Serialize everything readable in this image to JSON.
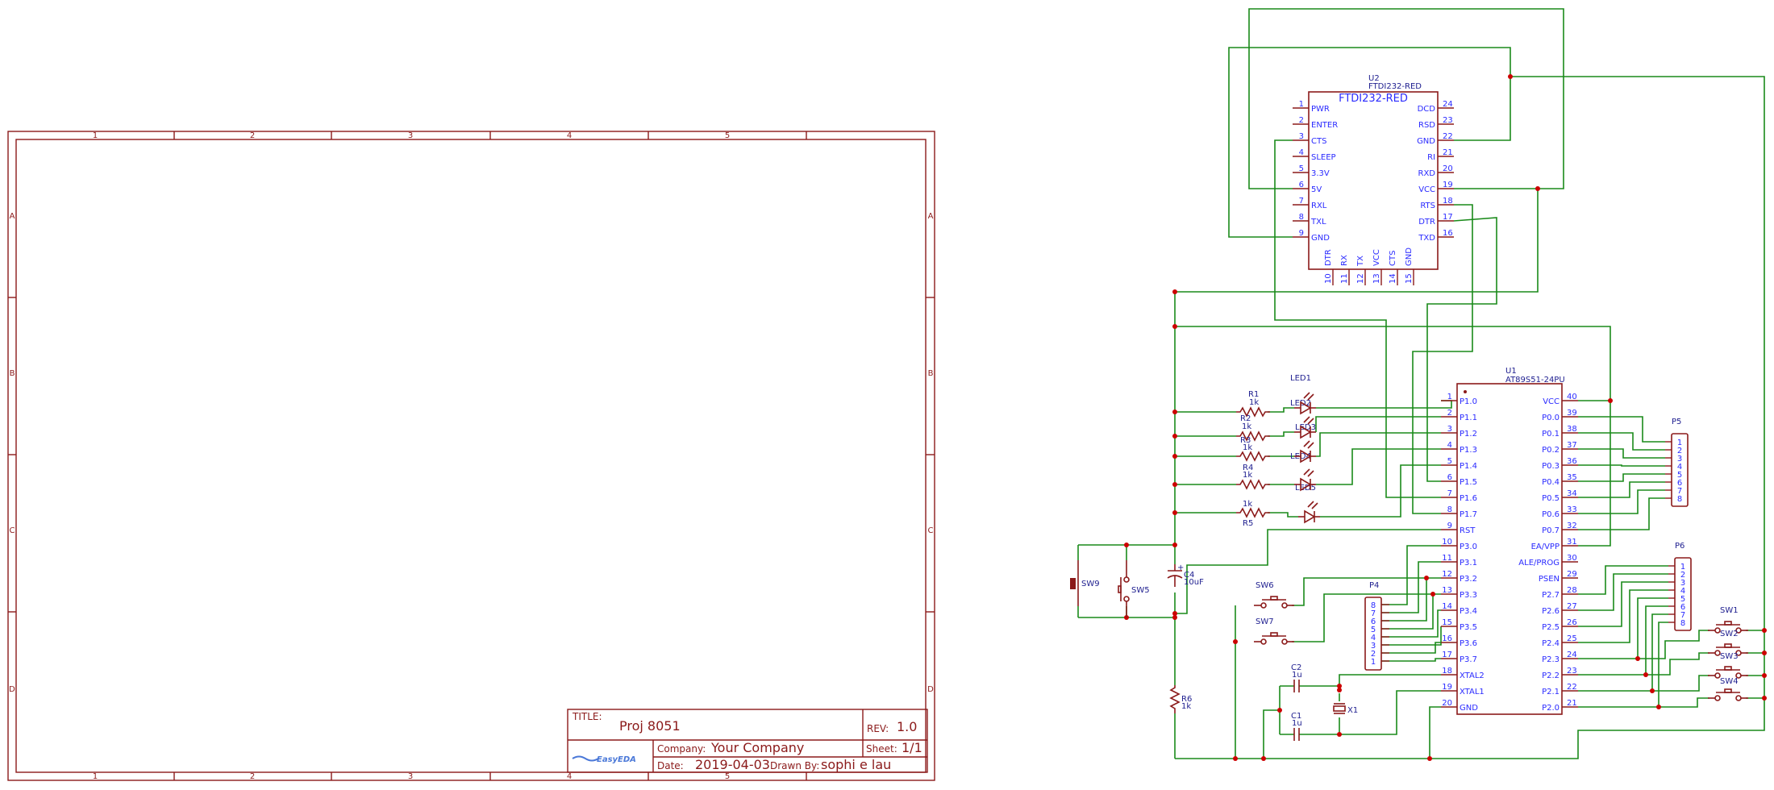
{
  "sheet": {
    "col_labels": [
      "1",
      "2",
      "3",
      "4",
      "5"
    ],
    "row_labels": [
      "A",
      "B",
      "C",
      "D"
    ]
  },
  "title_block": {
    "title_label": "TITLE:",
    "title": "Proj 8051",
    "rev_label": "REV:",
    "rev": "1.0",
    "company_label": "Company:",
    "company": "Your Company",
    "sheet_label": "Sheet:",
    "sheet": "1/1",
    "date_label": "Date:",
    "date": "2019-04-03",
    "drawn_by_label": "Drawn By:",
    "drawn_by": "sophi e lau",
    "logo": "EasyEDA"
  },
  "u2": {
    "ref": "U2",
    "part": "FTDI232-RED",
    "body_title": "FTDI232-RED",
    "left_pins": [
      {
        "num": "1",
        "name": "PWR"
      },
      {
        "num": "2",
        "name": "ENTER"
      },
      {
        "num": "3",
        "name": "CTS"
      },
      {
        "num": "4",
        "name": "SLEEP"
      },
      {
        "num": "5",
        "name": "3.3V"
      },
      {
        "num": "6",
        "name": "5V"
      },
      {
        "num": "7",
        "name": "RXL"
      },
      {
        "num": "8",
        "name": "TXL"
      },
      {
        "num": "9",
        "name": "GND"
      }
    ],
    "right_pins": [
      {
        "num": "24",
        "name": "DCD"
      },
      {
        "num": "23",
        "name": "RSD"
      },
      {
        "num": "22",
        "name": "GND"
      },
      {
        "num": "21",
        "name": "RI"
      },
      {
        "num": "20",
        "name": "RXD"
      },
      {
        "num": "19",
        "name": "VCC"
      },
      {
        "num": "18",
        "name": "RTS"
      },
      {
        "num": "17",
        "name": "DTR"
      },
      {
        "num": "16",
        "name": "TXD"
      }
    ],
    "bottom_pins": [
      {
        "num": "10",
        "name": "DTR"
      },
      {
        "num": "11",
        "name": "RX"
      },
      {
        "num": "12",
        "name": "TX"
      },
      {
        "num": "13",
        "name": "VCC"
      },
      {
        "num": "14",
        "name": "CTS"
      },
      {
        "num": "15",
        "name": "GND"
      }
    ]
  },
  "u1": {
    "ref": "U1",
    "part": "AT89S51-24PU",
    "left_pins": [
      {
        "num": "1",
        "name": "P1.0"
      },
      {
        "num": "2",
        "name": "P1.1"
      },
      {
        "num": "3",
        "name": "P1.2"
      },
      {
        "num": "4",
        "name": "P1.3"
      },
      {
        "num": "5",
        "name": "P1.4"
      },
      {
        "num": "6",
        "name": "P1.5"
      },
      {
        "num": "7",
        "name": "P1.6"
      },
      {
        "num": "8",
        "name": "P1.7"
      },
      {
        "num": "9",
        "name": "RST"
      },
      {
        "num": "10",
        "name": "P3.0"
      },
      {
        "num": "11",
        "name": "P3.1"
      },
      {
        "num": "12",
        "name": "P3.2"
      },
      {
        "num": "13",
        "name": "P3.3"
      },
      {
        "num": "14",
        "name": "P3.4"
      },
      {
        "num": "15",
        "name": "P3.5"
      },
      {
        "num": "16",
        "name": "P3.6"
      },
      {
        "num": "17",
        "name": "P3.7"
      },
      {
        "num": "18",
        "name": "XTAL2"
      },
      {
        "num": "19",
        "name": "XTAL1"
      },
      {
        "num": "20",
        "name": "GND"
      }
    ],
    "right_pins": [
      {
        "num": "40",
        "name": "VCC"
      },
      {
        "num": "39",
        "name": "P0.0"
      },
      {
        "num": "38",
        "name": "P0.1"
      },
      {
        "num": "37",
        "name": "P0.2"
      },
      {
        "num": "36",
        "name": "P0.3"
      },
      {
        "num": "35",
        "name": "P0.4"
      },
      {
        "num": "34",
        "name": "P0.5"
      },
      {
        "num": "33",
        "name": "P0.6"
      },
      {
        "num": "32",
        "name": "P0.7"
      },
      {
        "num": "31",
        "name": "EA/VPP"
      },
      {
        "num": "30",
        "name": "ALE/PROG"
      },
      {
        "num": "29",
        "name": "PSEN"
      },
      {
        "num": "28",
        "name": "P2.7"
      },
      {
        "num": "27",
        "name": "P2.6"
      },
      {
        "num": "26",
        "name": "P2.5"
      },
      {
        "num": "25",
        "name": "P2.4"
      },
      {
        "num": "24",
        "name": "P2.3"
      },
      {
        "num": "23",
        "name": "P2.2"
      },
      {
        "num": "22",
        "name": "P2.1"
      },
      {
        "num": "21",
        "name": "P2.0"
      }
    ]
  },
  "headers": {
    "P4": {
      "ref": "P4",
      "pins": [
        "8",
        "7",
        "6",
        "5",
        "4",
        "3",
        "2",
        "1"
      ]
    },
    "P5": {
      "ref": "P5",
      "pins": [
        "1",
        "2",
        "3",
        "4",
        "5",
        "6",
        "7",
        "8"
      ]
    },
    "P6": {
      "ref": "P6",
      "pins": [
        "1",
        "2",
        "3",
        "4",
        "5",
        "6",
        "7",
        "8"
      ]
    }
  },
  "parts": {
    "R1": {
      "ref": "R1",
      "value": "1k"
    },
    "R2": {
      "ref": "R2",
      "value": "1k"
    },
    "R3": {
      "ref": "R3",
      "value": "1k"
    },
    "R4": {
      "ref": "R4",
      "value": "1k"
    },
    "R5": {
      "ref": "R5",
      "value": "1k"
    },
    "R6": {
      "ref": "R6",
      "value": "1k"
    },
    "LED1": {
      "ref": "LED1"
    },
    "LED2": {
      "ref": "LED2"
    },
    "LED3": {
      "ref": "LED3"
    },
    "LED4": {
      "ref": "LED4"
    },
    "LED5": {
      "ref": "LED5"
    },
    "C1": {
      "ref": "C1",
      "value": "1u"
    },
    "C2": {
      "ref": "C2",
      "value": "1u"
    },
    "C4": {
      "ref": "C4",
      "value": "10uF"
    },
    "X1": {
      "ref": "X1"
    },
    "SW1": {
      "ref": "SW1"
    },
    "SW2": {
      "ref": "SW2"
    },
    "SW3": {
      "ref": "SW3"
    },
    "SW4": {
      "ref": "SW4"
    },
    "SW5": {
      "ref": "SW5"
    },
    "SW6": {
      "ref": "SW6"
    },
    "SW7": {
      "ref": "SW7"
    },
    "SW9": {
      "ref": "SW9"
    }
  },
  "colors": {
    "frame": "#8b1a1a",
    "wire": "#1a8a1a",
    "pin_text": "#2a2aff",
    "designator": "#202090",
    "junction": "#cc0000"
  }
}
